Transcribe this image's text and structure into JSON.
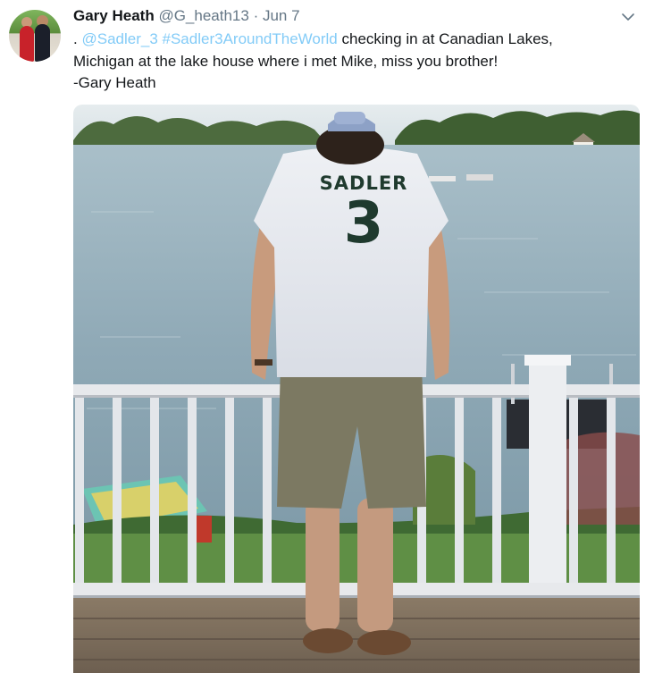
{
  "tweet": {
    "author_name": "Gary Heath",
    "handle": "@G_heath13",
    "separator": "·",
    "date": "Jun 7",
    "text_prefix": ".",
    "mention": "@Sadler_3",
    "hashtag": "#Sadler3AroundTheWorld",
    "text_line1_rest": "checking in at Canadian Lakes,",
    "text_line2": "Michigan at the lake house where i met Mike, miss you brother!",
    "text_line3": "-Gary Heath"
  },
  "media": {
    "shirt_name": "SADLER",
    "shirt_number": "3"
  },
  "icons": {
    "caret": "chevron-down-icon",
    "avatar": "avatar-photo"
  },
  "colors": {
    "link": "#1da1f2",
    "secondary_text": "#657786",
    "primary_text": "#14171a"
  }
}
